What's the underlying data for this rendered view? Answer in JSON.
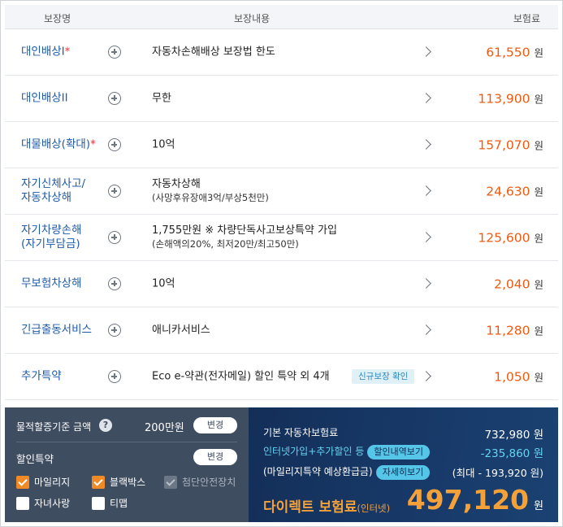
{
  "header": {
    "col_name": "보장명",
    "col_desc": "보장내용",
    "col_premium": "보험료"
  },
  "currency": "원",
  "rows": [
    {
      "name": "대인배상I",
      "star": "*",
      "desc": "자동차손해배상 보장법 한도",
      "sub": "",
      "tag": "",
      "premium": "61,550"
    },
    {
      "name": "대인배상II",
      "star": "",
      "desc": "무한",
      "sub": "",
      "tag": "",
      "premium": "113,900"
    },
    {
      "name": "대물배상(확대)",
      "star": "*",
      "desc": "10억",
      "sub": "",
      "tag": "",
      "premium": "157,070"
    },
    {
      "name": "자기신체사고/\n자동차상해",
      "star": "",
      "desc": "자동차상해",
      "sub": "(사망후유장애3억/부상5천만)",
      "tag": "",
      "premium": "24,630"
    },
    {
      "name": "자기차량손해\n(자기부담금)",
      "star": "",
      "desc": "1,755만원 ※ 차량단독사고보상특약 가입",
      "sub": "(손해액의20%, 최저20만/최고50만)",
      "tag": "",
      "premium": "125,600"
    },
    {
      "name": "무보험차상해",
      "star": "",
      "desc": "10억",
      "sub": "",
      "tag": "",
      "premium": "2,040"
    },
    {
      "name": "긴급출동서비스",
      "star": "",
      "desc": "애니카서비스",
      "sub": "",
      "tag": "",
      "premium": "11,280"
    },
    {
      "name": "추가특약",
      "star": "",
      "desc": "Eco e-약관(전자메일) 할인 특약 외 4개",
      "sub": "",
      "tag": "신규보장 확인",
      "premium": "1,050"
    }
  ],
  "left_panel": {
    "property_label": "물적할증기준 금액",
    "help_icon": "?",
    "property_value": "200만원",
    "change_label": "변경",
    "discount_label": "할인특약",
    "checkboxes": [
      {
        "label": "마일리지",
        "state": "checked"
      },
      {
        "label": "블랙박스",
        "state": "checked"
      },
      {
        "label": "첨단안전장치",
        "state": "disabled"
      },
      {
        "label": "자녀사랑",
        "state": "empty"
      },
      {
        "label": "티맵",
        "state": "empty"
      }
    ]
  },
  "right_panel": {
    "base_label": "기본 자동차보험료",
    "base_value": "732,980",
    "discount_label": "인터넷가입+추가할인 등",
    "discount_button": "할인내역보기",
    "discount_value": "-235,860",
    "mileage_label": "(마일리지특약 예상환급금)",
    "mileage_button": "자세히보기",
    "mileage_value": "(최대 - 193,920 원)",
    "final_label": "다이렉트 보험료",
    "final_sub": "(인터넷)",
    "final_value": "497,120"
  },
  "colors": {
    "accent_orange": "#ee5a10",
    "name_blue": "#1f5aa8",
    "panel_dark": "#3f4d61",
    "panel_navy": "#132f58"
  }
}
